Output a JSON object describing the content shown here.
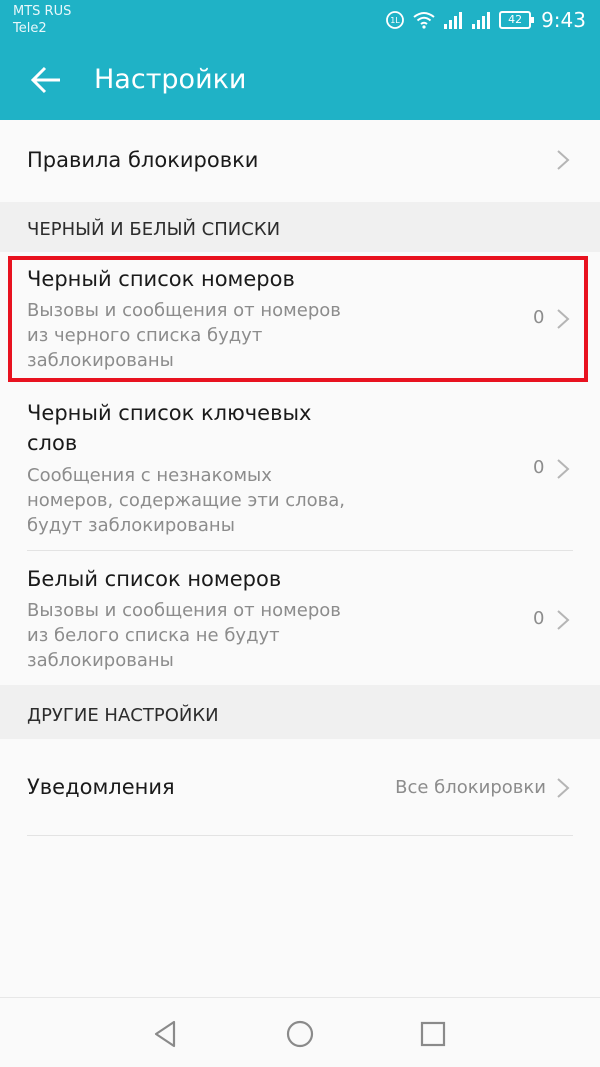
{
  "status_bar": {
    "carrier1": "MTS RUS",
    "carrier2": "Tele2",
    "battery": "42",
    "time": "9:43"
  },
  "app_bar": {
    "title": "Настройки",
    "back_icon": "arrow-back-icon"
  },
  "items": {
    "block_rules": {
      "title": "Правила блокировки"
    },
    "section_lists": "ЧЕРНЫЙ И БЕЛЫЙ СПИСКИ",
    "blacklist_numbers": {
      "title": "Черный список номеров",
      "sub1": "Вызовы и сообщения от номеров",
      "sub2": "из черного списка будут",
      "sub3": "заблокированы",
      "value": "0"
    },
    "blacklist_keywords": {
      "title1": "Черный список ключевых",
      "title2": "слов",
      "sub1": "Сообщения с незнакомых",
      "sub2": "номеров, содержащие эти слова,",
      "sub3": "будут заблокированы",
      "value": "0"
    },
    "whitelist_numbers": {
      "title": "Белый список номеров",
      "sub1": "Вызовы и сообщения от номеров",
      "sub2": "из белого списка не будут",
      "sub3": "заблокированы",
      "value": "0"
    },
    "section_other": "ДРУГИЕ НАСТРОЙКИ",
    "notifications": {
      "title": "Уведомления",
      "value": "Все блокировки"
    }
  },
  "colors": {
    "accent": "#1fb2c6",
    "highlight": "#e8121f"
  }
}
